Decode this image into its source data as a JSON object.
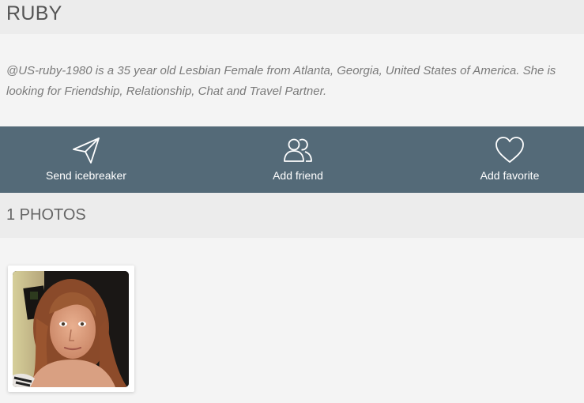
{
  "profile": {
    "name": "RUBY",
    "bio": "@US-ruby-1980 is a 35 year old Lesbian Female from Atlanta, Georgia, United States of America. She is looking for Friendship, Relationship, Chat and Travel Partner."
  },
  "actions": [
    {
      "label": "Send icebreaker",
      "icon": "paper-plane-icon"
    },
    {
      "label": "Add friend",
      "icon": "users-icon"
    },
    {
      "label": "Add favorite",
      "icon": "heart-icon"
    }
  ],
  "photos": {
    "title": "1 PHOTOS",
    "count": 1
  },
  "colors": {
    "action_bar": "#546a78",
    "header_bg": "#ececec",
    "page_bg": "#f4f4f4"
  }
}
